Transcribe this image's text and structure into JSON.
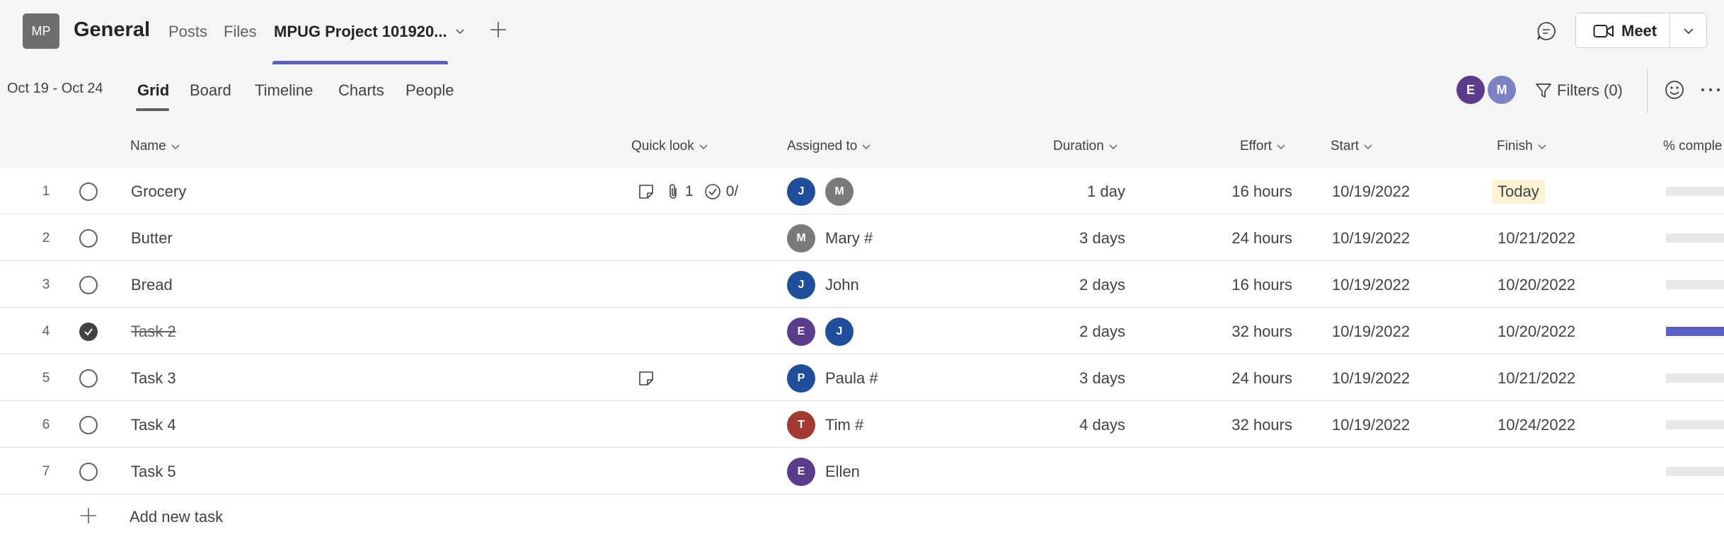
{
  "header": {
    "team_initials": "MP",
    "channel_name": "General",
    "tabs": [
      {
        "label": "Posts"
      },
      {
        "label": "Files"
      },
      {
        "label": "MPUG Project 101920..."
      }
    ],
    "meet_label": "Meet"
  },
  "viewbar": {
    "date_range": "Oct 19 - Oct 24",
    "tabs": [
      {
        "label": "Grid"
      },
      {
        "label": "Board"
      },
      {
        "label": "Timeline"
      },
      {
        "label": "Charts"
      },
      {
        "label": "People"
      }
    ],
    "members": [
      "E",
      "M"
    ],
    "filters_label": "Filters (0)"
  },
  "columns": {
    "name": "Name",
    "quick_look": "Quick look",
    "assigned_to": "Assigned to",
    "duration": "Duration",
    "effort": "Effort",
    "start": "Start",
    "finish": "Finish",
    "percent_complete": "% comple"
  },
  "tasks": [
    {
      "num": "1",
      "name": "Grocery",
      "completed": false,
      "quick_look": {
        "note": true,
        "attachments": "1",
        "checklist": "0/"
      },
      "assignees": [
        "J",
        "M"
      ],
      "assignee_name": "",
      "duration": "1 day",
      "effort": "16 hours",
      "start": "10/19/2022",
      "finish": "Today",
      "progress": 0
    },
    {
      "num": "2",
      "name": "Butter",
      "completed": false,
      "assignees": [
        "M"
      ],
      "assignee_name": "Mary #",
      "duration": "3 days",
      "effort": "24 hours",
      "start": "10/19/2022",
      "finish": "10/21/2022",
      "progress": 0
    },
    {
      "num": "3",
      "name": "Bread",
      "completed": false,
      "assignees": [
        "J"
      ],
      "assignee_name": "John",
      "duration": "2 days",
      "effort": "16 hours",
      "start": "10/19/2022",
      "finish": "10/20/2022",
      "progress": 0
    },
    {
      "num": "4",
      "name": "Task 2",
      "completed": true,
      "assignees": [
        "E",
        "J"
      ],
      "assignee_name": "",
      "duration": "2 days",
      "effort": "32 hours",
      "start": "10/19/2022",
      "finish": "10/20/2022",
      "progress": 1
    },
    {
      "num": "5",
      "name": "Task 3",
      "completed": false,
      "quick_look": {
        "note": true
      },
      "assignees": [
        "P"
      ],
      "assignee_name": "Paula #",
      "duration": "3 days",
      "effort": "24 hours",
      "start": "10/19/2022",
      "finish": "10/21/2022",
      "progress": 0
    },
    {
      "num": "6",
      "name": "Task 4",
      "completed": false,
      "assignees": [
        "T"
      ],
      "assignee_name": "Tim #",
      "duration": "4 days",
      "effort": "32 hours",
      "start": "10/19/2022",
      "finish": "10/24/2022",
      "progress": 0
    },
    {
      "num": "7",
      "name": "Task 5",
      "completed": false,
      "assignees": [
        "E"
      ],
      "assignee_name": "Ellen",
      "duration": "",
      "effort": "",
      "start": "",
      "finish": "",
      "progress": 0
    }
  ],
  "add_task_label": "Add new task",
  "colors": {
    "accent": "#5b5fc7",
    "today_highlight": "#fdf3d2",
    "avatar_J": "#1f4e9a",
    "avatar_M": "#7a7a7a",
    "avatar_E": "#5b3b8c",
    "avatar_P": "#1f4e9a",
    "avatar_T": "#a33a31"
  },
  "icons": {
    "note": "note-icon",
    "attachment": "paperclip-icon",
    "checklist": "checklist-icon",
    "check": "checkmark-icon"
  }
}
